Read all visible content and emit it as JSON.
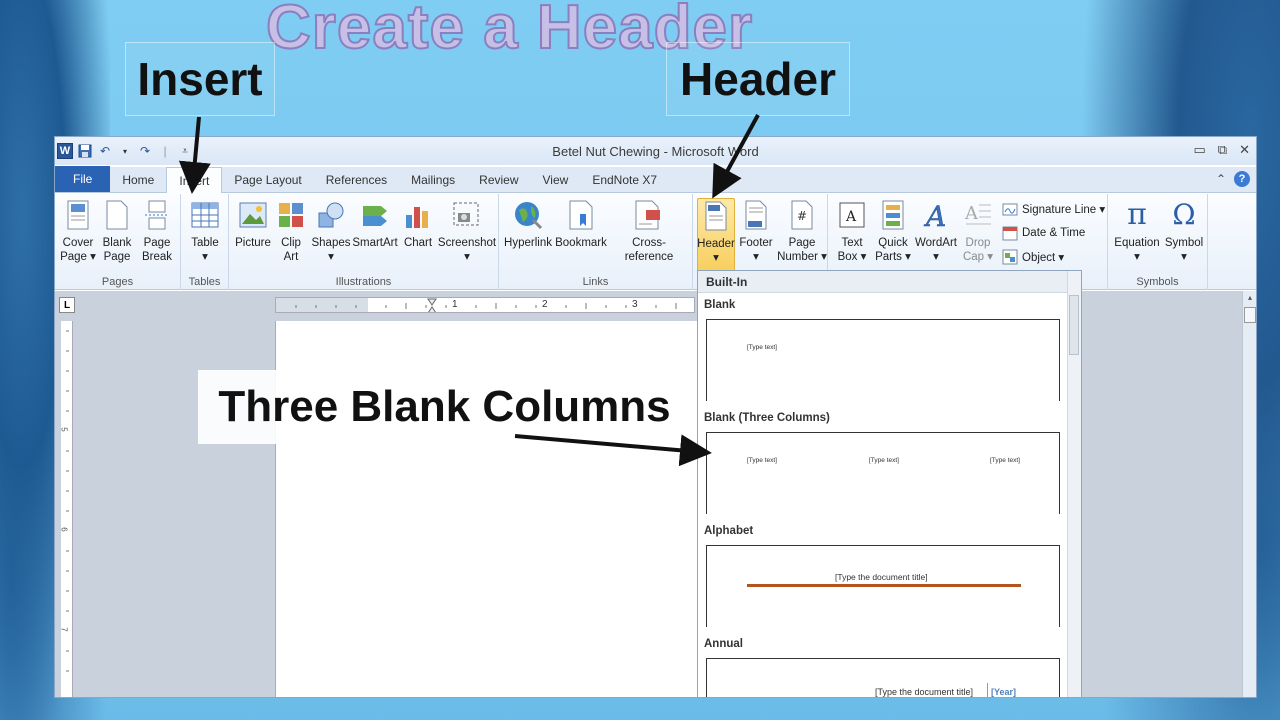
{
  "slide": {
    "title": "Create a Header",
    "callouts": {
      "insert": "Insert",
      "header": "Header",
      "three_columns": "Three Blank Columns"
    }
  },
  "window": {
    "title": "Betel Nut Chewing  -  Microsoft Word",
    "app_icon_letter": "W",
    "controls": [
      "minimize-icon",
      "restore-icon",
      "close-icon"
    ]
  },
  "tabs": [
    {
      "label": "File"
    },
    {
      "label": "Home"
    },
    {
      "label": "Insert"
    },
    {
      "label": "Page Layout"
    },
    {
      "label": "References"
    },
    {
      "label": "Mailings"
    },
    {
      "label": "Review"
    },
    {
      "label": "View"
    },
    {
      "label": "EndNote X7"
    }
  ],
  "ribbon": {
    "groups": {
      "pages": "Pages",
      "tables": "Tables",
      "illustrations": "Illustrations",
      "links": "Links",
      "symbols": "Symbols"
    },
    "buttons": {
      "cover_page": [
        "Cover",
        "Page ▾"
      ],
      "blank_page": [
        "Blank",
        "Page"
      ],
      "page_break": [
        "Page",
        "Break"
      ],
      "table": [
        "Table",
        "▾"
      ],
      "picture": [
        "Picture",
        ""
      ],
      "clip_art": [
        "Clip",
        "Art"
      ],
      "shapes": [
        "Shapes",
        "▾"
      ],
      "smartart": [
        "SmartArt",
        ""
      ],
      "chart": [
        "Chart",
        ""
      ],
      "screenshot": [
        "Screenshot",
        "▾"
      ],
      "hyperlink": [
        "Hyperlink",
        ""
      ],
      "bookmark": [
        "Bookmark",
        ""
      ],
      "cross_reference": [
        "Cross-reference",
        ""
      ],
      "header": [
        "Header",
        "▾"
      ],
      "footer": [
        "Footer",
        "▾"
      ],
      "page_number": [
        "Page",
        "Number ▾"
      ],
      "text_box": [
        "Text",
        "Box ▾"
      ],
      "quick_parts": [
        "Quick",
        "Parts ▾"
      ],
      "wordart": [
        "WordArt",
        "▾"
      ],
      "drop_cap": [
        "Drop",
        "Cap ▾"
      ],
      "equation": [
        "Equation",
        "▾"
      ],
      "symbol": [
        "Symbol",
        "▾"
      ]
    },
    "small": {
      "signature_line": "Signature Line ▾",
      "date_time": "Date & Time",
      "object": "Object ▾"
    }
  },
  "ruler": {
    "corner": "L",
    "marks": [
      "1",
      "2",
      "3"
    ],
    "vmarks": [
      "5",
      "6",
      "7"
    ]
  },
  "gallery": {
    "heading": "Built-In",
    "items": [
      {
        "title": "Blank",
        "texts": [
          "[Type text]"
        ]
      },
      {
        "title": "Blank (Three Columns)",
        "texts": [
          "[Type text]",
          "[Type text]",
          "[Type text]"
        ]
      },
      {
        "title": "Alphabet",
        "texts": [
          "[Type the document title]"
        ]
      },
      {
        "title": "Annual",
        "texts": [
          "[Type the document title]",
          "[Year]"
        ]
      }
    ]
  },
  "colors": {
    "ribbon_accent": "#2b63b4",
    "selected_button": "#f8cf5e",
    "alphabet_rule": "#b3541e",
    "annual_year": "#4f81bd"
  }
}
